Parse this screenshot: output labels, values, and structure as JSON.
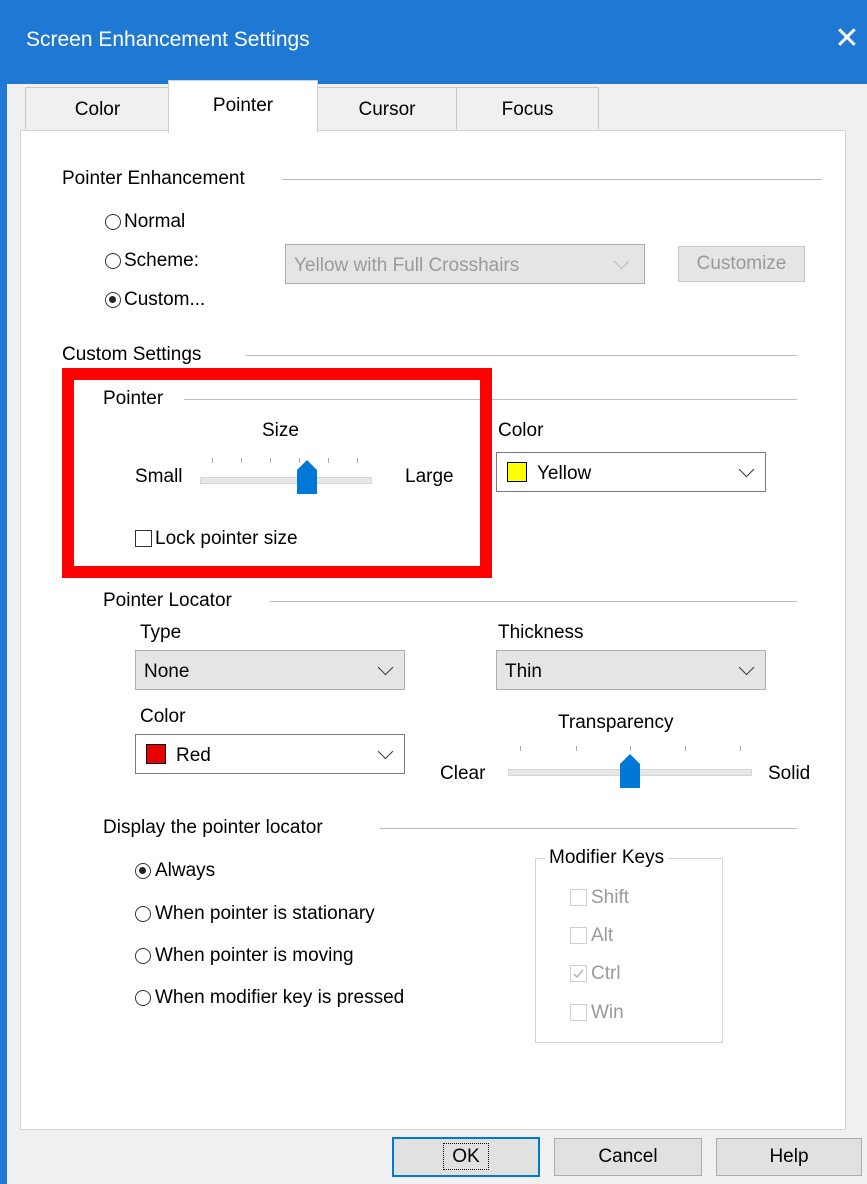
{
  "window": {
    "title": "Screen Enhancement Settings"
  },
  "tabs": [
    {
      "label": "Color",
      "active": false
    },
    {
      "label": "Pointer",
      "active": true
    },
    {
      "label": "Cursor",
      "active": false
    },
    {
      "label": "Focus",
      "active": false
    }
  ],
  "pointer_enhancement": {
    "heading": "Pointer Enhancement",
    "options": [
      {
        "label": "Normal",
        "selected": false
      },
      {
        "label": "Scheme:",
        "selected": false
      },
      {
        "label": "Custom...",
        "selected": true
      }
    ],
    "scheme_value": "Yellow with Full Crosshairs",
    "customize_label": "Customize"
  },
  "custom_settings": {
    "heading": "Custom Settings",
    "pointer": {
      "heading": "Pointer",
      "size_label": "Size",
      "small_label": "Small",
      "large_label": "Large",
      "size_level": 0.62,
      "lock_label": "Lock pointer size",
      "lock_checked": false
    },
    "color": {
      "label": "Color",
      "value": "Yellow",
      "swatch": "#ffff00"
    }
  },
  "pointer_locator": {
    "heading": "Pointer Locator",
    "type_label": "Type",
    "type_value": "None",
    "thickness_label": "Thickness",
    "thickness_value": "Thin",
    "color_label": "Color",
    "color_value": "Red",
    "color_swatch": "#e60000",
    "transparency_label": "Transparency",
    "clear_label": "Clear",
    "solid_label": "Solid",
    "transparency_level": 0.5
  },
  "display_locator": {
    "heading": "Display the pointer locator",
    "options": [
      {
        "label": "Always",
        "selected": true
      },
      {
        "label": "When pointer is stationary",
        "selected": false
      },
      {
        "label": "When pointer is moving",
        "selected": false
      },
      {
        "label": "When modifier key is pressed",
        "selected": false
      }
    ],
    "modifier_heading": "Modifier Keys",
    "modifiers": [
      {
        "label": "Shift",
        "checked": false
      },
      {
        "label": "Alt",
        "checked": false
      },
      {
        "label": "Ctrl",
        "checked": true
      },
      {
        "label": "Win",
        "checked": false
      }
    ]
  },
  "buttons": {
    "ok": "OK",
    "cancel": "Cancel",
    "help": "Help"
  },
  "highlight_color": "#ff0000"
}
